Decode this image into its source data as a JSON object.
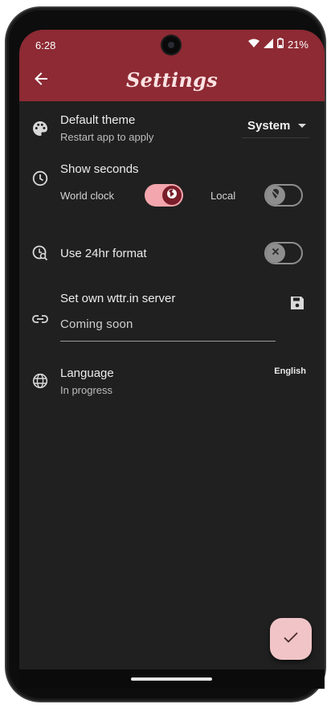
{
  "status_bar": {
    "time": "6:28",
    "battery": "21%",
    "icons": [
      "wifi-icon",
      "signal-icon",
      "battery-icon"
    ]
  },
  "app_bar": {
    "title": "Settings",
    "back_icon": "arrow-back-icon",
    "color": "#8d2a33"
  },
  "settings": {
    "default_theme": {
      "title": "Default theme",
      "subtitle": "Restart app to apply",
      "value": "System",
      "icon": "palette-icon"
    },
    "show_seconds": {
      "title": "Show seconds",
      "icon": "clock-icon",
      "world_clock_label": "World clock",
      "world_clock_on": true,
      "local_label": "Local",
      "local_on": false
    },
    "format_24hr": {
      "title": "Use 24hr format",
      "icon": "clock-search-icon",
      "on": false
    },
    "wttr_server": {
      "title": "Set own wttr.in server",
      "placeholder": "Coming soon",
      "icon": "link-icon",
      "save_icon": "save-icon"
    },
    "language": {
      "title": "Language",
      "subtitle": "In progress",
      "value": "English",
      "icon": "globe-icon"
    }
  },
  "fab": {
    "icon": "check-icon",
    "color": "#f1c5c7"
  },
  "colors": {
    "background": "#202020",
    "accent": "#f3a6ad",
    "thumb_on": "#7a1d2a"
  }
}
